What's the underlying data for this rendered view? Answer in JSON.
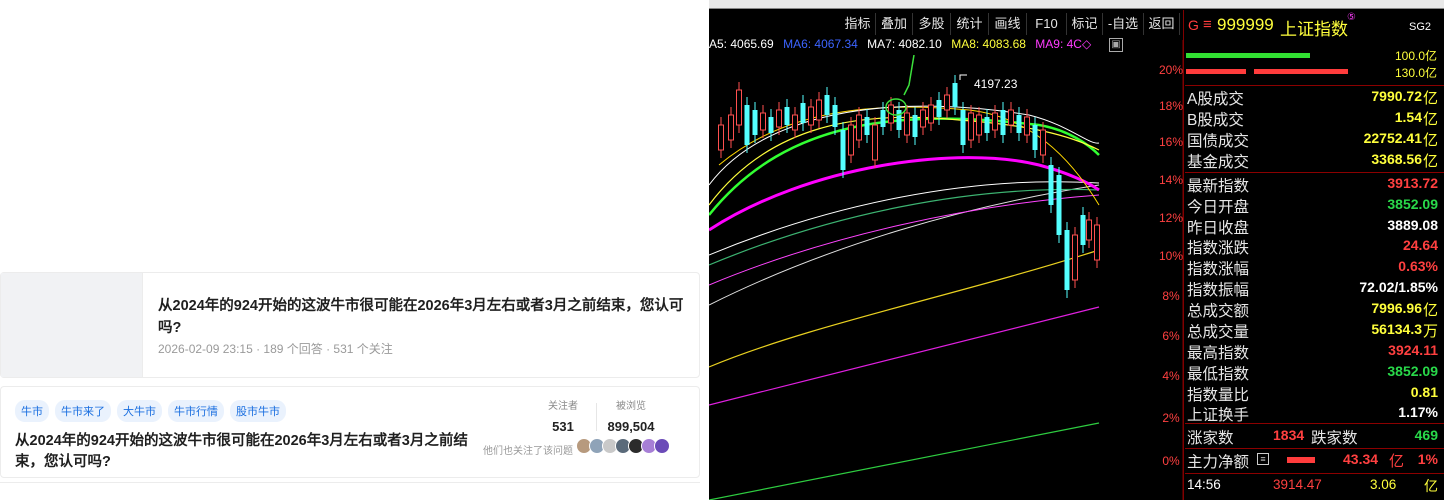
{
  "left": {
    "card1": {
      "title": "从2024年的924开始的这波牛市很可能在2026年3月左右或者3月之前结束，您认可吗?",
      "meta": "2026-02-09 23:15 · 189 个回答 · 531 个关注"
    },
    "card2": {
      "tags": [
        "牛市",
        "牛市来了",
        "大牛市",
        "牛市行情",
        "股市牛市"
      ],
      "followers_label": "关注者",
      "followers": "531",
      "views_label": "被浏览",
      "views": "899,504",
      "title": "从2024年的924开始的这波牛市很可能在2026年3月左右或者3月之前结束，您认可吗?",
      "also_followed": "他们也关注了该问题"
    }
  },
  "chart": {
    "toolbar": [
      "指标",
      "叠加",
      "多股",
      "统计",
      "画线",
      "F10",
      "标记",
      "-自选",
      "返回"
    ],
    "header": {
      "g": "G",
      "menu": "≡",
      "code": "999999",
      "name": "上证指数",
      "badge": "SG2"
    },
    "ma_line": [
      {
        "text": "A5: 4065.69",
        "color": "#ffffff"
      },
      {
        "text": "MA6: 4067.34",
        "color": "#3c64ff"
      },
      {
        "text": "MA7: 4082.10",
        "color": "#ffffff"
      },
      {
        "text": "MA8: 4083.68",
        "color": "#ffff3c"
      },
      {
        "text": "MA9: 4C◇",
        "color": "#ff3cff"
      }
    ],
    "high_label": "4197.23",
    "pct_axis": [
      "20%",
      "18%",
      "16%",
      "14%",
      "12%",
      "10%",
      "8%",
      "6%",
      "4%",
      "2%",
      "0%"
    ],
    "bars": {
      "top": "100.0亿",
      "bottom": "130.0亿"
    },
    "stats": [
      {
        "k": "A股成交",
        "v": "7990.72",
        "u": "亿",
        "vc": "yellow"
      },
      {
        "k": "B股成交",
        "v": "1.54",
        "u": "亿",
        "vc": "yellow"
      },
      {
        "k": "国债成交",
        "v": "22752.41",
        "u": "亿",
        "vc": "yellow"
      },
      {
        "k": "基金成交",
        "v": "3368.56",
        "u": "亿",
        "vc": "yellow"
      },
      {
        "k": "最新指数",
        "v": "3913.72",
        "u": "",
        "vc": "red"
      },
      {
        "k": "今日开盘",
        "v": "3852.09",
        "u": "",
        "vc": "green"
      },
      {
        "k": "昨日收盘",
        "v": "3889.08",
        "u": "",
        "vc": "white"
      },
      {
        "k": "指数涨跌",
        "v": "24.64",
        "u": "",
        "vc": "red"
      },
      {
        "k": "指数涨幅",
        "v": "0.63%",
        "u": "",
        "vc": "red"
      },
      {
        "k": "指数振幅",
        "v": "72.02/1.85%",
        "u": "",
        "vc": "white"
      },
      {
        "k": "总成交额",
        "v": "7996.96",
        "u": "亿",
        "vc": "yellow"
      },
      {
        "k": "总成交量",
        "v": "56134.3",
        "u": "万",
        "vc": "yellow"
      },
      {
        "k": "最高指数",
        "v": "3924.11",
        "u": "",
        "vc": "red"
      },
      {
        "k": "最低指数",
        "v": "3852.09",
        "u": "",
        "vc": "green"
      },
      {
        "k": "指数量比",
        "v": "0.81",
        "u": "",
        "vc": "yellow"
      },
      {
        "k": "上证换手",
        "v": "1.17%",
        "u": "",
        "vc": "white"
      }
    ],
    "updown": {
      "up_label": "涨家数",
      "up": "1834",
      "down_label": "跌家数",
      "down": "469"
    },
    "main_flow": {
      "label": "主力净额",
      "value": "43.34",
      "unit": "亿",
      "pct": "1%"
    },
    "ticks": [
      {
        "time": "14:56",
        "price": "3914.47",
        "vol": "3.06",
        "unit": "亿"
      }
    ]
  }
}
